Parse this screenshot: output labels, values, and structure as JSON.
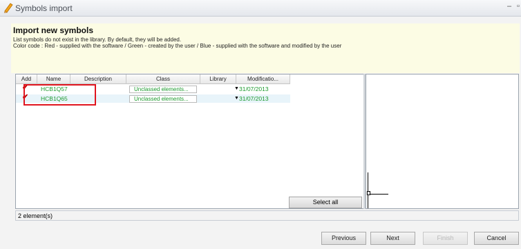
{
  "window": {
    "title": "Symbols import",
    "minimize_glyph": "–",
    "maximize_glyph": "▫"
  },
  "header": {
    "title": "Import new symbols",
    "line1": "List symbols do not exist in the library. By default, they will be added.",
    "line2": "Color code : Red - supplied with the software / Green - created by the user / Blue - supplied with the software and modified by the user"
  },
  "grid": {
    "columns": [
      "Add",
      "Name",
      "Description",
      "Class",
      "Library",
      "Modificatio..."
    ],
    "rows": [
      {
        "checked": true,
        "name": "HCB1Q57",
        "description": "",
        "class": "Unclassed elements...",
        "library": "",
        "modification": "31/07/2013"
      },
      {
        "checked": true,
        "name": "HCB1Q65",
        "description": "",
        "class": "Unclassed elements...",
        "library": "",
        "modification": "31/07/2013"
      }
    ]
  },
  "select_all_label": "Select all",
  "status": "2 element(s)",
  "buttons": {
    "previous": "Previous",
    "next": "Next",
    "finish": "Finish",
    "cancel": "Cancel"
  },
  "colors": {
    "name_color": "#1c9a2e",
    "check_color": "#c00000",
    "highlight_border": "#e0141e",
    "header_bg": "#fcfce4",
    "alt_row_bg": "#e8f4fa"
  },
  "icons": {
    "app": "pencil-edit-icon",
    "row_check": "checkmark-icon",
    "dropdown": "dropdown-arrow-icon"
  }
}
